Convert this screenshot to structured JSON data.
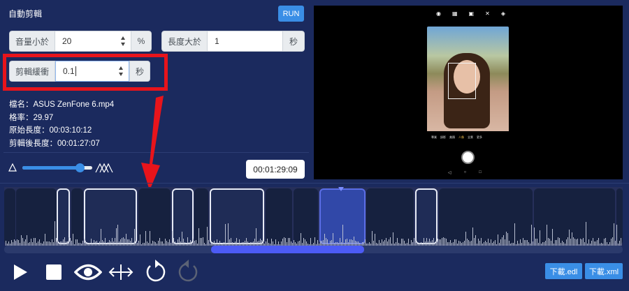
{
  "header": {
    "title": "自動剪輯",
    "run_label": "RUN"
  },
  "volume": {
    "label": "音量小於",
    "value": "20",
    "unit": "%"
  },
  "length": {
    "label": "長度大於",
    "value": "1",
    "unit": "秒"
  },
  "buffer": {
    "label": "剪輯緩衝",
    "value": "0.1",
    "unit": "秒"
  },
  "info": {
    "filename": "檔名：ASUS ZenFone 6.mp4",
    "fps": "格率：29.97",
    "original_length": "原始長度：00:03:10:12",
    "edited_length": "剪輯後長度：00:01:27:07"
  },
  "sensitivity": {
    "fraction": 0.82,
    "low_icon": "triangle-icon",
    "high_icon": "mountains-icon"
  },
  "current_time": "00:01:29:09",
  "preview": {
    "top_icons": [
      "◉",
      "▦",
      "▣",
      "✕",
      "◈"
    ],
    "modes": [
      "專業",
      "錄影",
      "美顏",
      "人像",
      "全景",
      "更多"
    ],
    "nav": [
      "◁",
      "○",
      "□"
    ]
  },
  "timeline": {
    "scroll_start": 0.335,
    "scroll_end": 0.582
  },
  "controls": {
    "play": "play-icon",
    "stop": "stop-icon",
    "preview": "eye-icon",
    "fit": "arrows-horizontal-icon",
    "undo": "undo-icon",
    "redo": "redo-icon"
  },
  "downloads": {
    "edl": "下載.edl",
    "xml": "下載.xml"
  },
  "colors": {
    "background": "#1b2a5e",
    "accent": "#3a8ee6",
    "highlight": "#e8141b",
    "scrollbar": "#4c5bf5"
  }
}
